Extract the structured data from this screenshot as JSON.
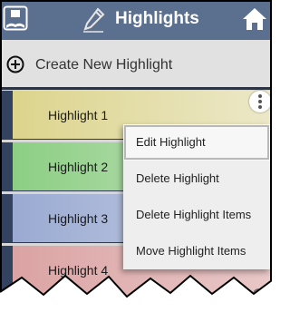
{
  "header": {
    "title": "Highlights",
    "left_icon": "book-icon",
    "pen_icon": "pen-icon",
    "home_icon": "home-icon"
  },
  "create": {
    "label": "Create New Highlight",
    "icon": "plus-circle-icon"
  },
  "highlights": [
    {
      "label": "Highlight 1",
      "color": "#dcd48c"
    },
    {
      "label": "Highlight 2",
      "color": "#8ccf83"
    },
    {
      "label": "Highlight 3",
      "color": "#9aaad2"
    },
    {
      "label": "Highlight 4",
      "color": "#dba3a3"
    }
  ],
  "row_more_icon": "more-vertical-icon",
  "context_menu": {
    "items": [
      {
        "label": "Edit Highlight",
        "selected": true
      },
      {
        "label": "Delete Highlight",
        "selected": false
      },
      {
        "label": "Delete Highlight Items",
        "selected": false
      },
      {
        "label": "Move Highlight Items",
        "selected": false
      }
    ]
  },
  "colors": {
    "header_bg": "#5b6f8f",
    "tab": "#33425e",
    "background": "#e1e1e1"
  }
}
